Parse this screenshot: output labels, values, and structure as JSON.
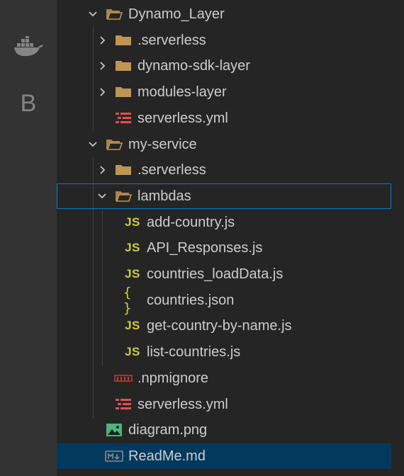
{
  "activity_bar": {
    "items": [
      {
        "name": "docker-icon"
      },
      {
        "name": "b-extension-icon",
        "glyph": "B"
      }
    ]
  },
  "explorer": {
    "items": [
      {
        "label": "Dynamo_Layer",
        "kind": "folder",
        "expanded": true,
        "icon": "folder-open-icon"
      },
      {
        "label": ".serverless",
        "kind": "folder",
        "expanded": false,
        "icon": "folder-icon"
      },
      {
        "label": "dynamo-sdk-layer",
        "kind": "folder",
        "expanded": false,
        "icon": "folder-icon"
      },
      {
        "label": "modules-layer",
        "kind": "folder",
        "expanded": false,
        "icon": "folder-icon"
      },
      {
        "label": "serverless.yml",
        "kind": "file",
        "icon": "yaml-icon"
      },
      {
        "label": "my-service",
        "kind": "folder",
        "expanded": true,
        "icon": "folder-open-icon"
      },
      {
        "label": ".serverless",
        "kind": "folder",
        "expanded": false,
        "icon": "folder-icon"
      },
      {
        "label": "lambdas",
        "kind": "folder",
        "expanded": true,
        "icon": "folder-open-icon",
        "focused": true
      },
      {
        "label": "add-country.js",
        "kind": "file",
        "icon": "js-icon",
        "badge": "JS"
      },
      {
        "label": "API_Responses.js",
        "kind": "file",
        "icon": "js-icon",
        "badge": "JS"
      },
      {
        "label": "countries_loadData.js",
        "kind": "file",
        "icon": "js-icon",
        "badge": "JS"
      },
      {
        "label": "countries.json",
        "kind": "file",
        "icon": "json-icon",
        "badge": "{ }"
      },
      {
        "label": "get-country-by-name.js",
        "kind": "file",
        "icon": "js-icon",
        "badge": "JS"
      },
      {
        "label": "list-countries.js",
        "kind": "file",
        "icon": "js-icon",
        "badge": "JS"
      },
      {
        "label": ".npmignore",
        "kind": "file",
        "icon": "npm-icon"
      },
      {
        "label": "serverless.yml",
        "kind": "file",
        "icon": "yaml-icon"
      },
      {
        "label": "diagram.png",
        "kind": "file",
        "icon": "image-icon"
      },
      {
        "label": "ReadMe.md",
        "kind": "file",
        "icon": "markdown-icon",
        "badge": "M↓",
        "selected": true
      }
    ]
  },
  "colors": {
    "folder": "#c09553",
    "js": "#cbcb41",
    "yaml": "#e44e4f",
    "image": "#4fb27f",
    "selection": "#04395e",
    "focus_border": "#007fd4"
  }
}
